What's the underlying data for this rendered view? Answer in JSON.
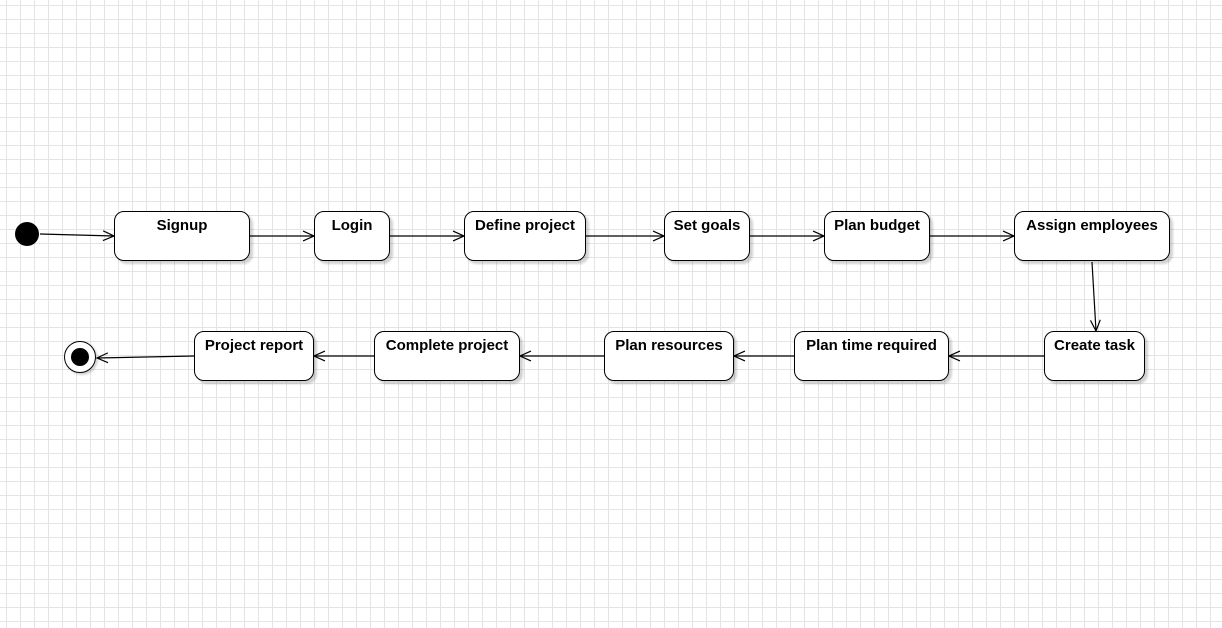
{
  "diagram": {
    "states": [
      {
        "id": "signup",
        "label": "Signup"
      },
      {
        "id": "login",
        "label": "Login"
      },
      {
        "id": "define-project",
        "label": "Define project"
      },
      {
        "id": "set-goals",
        "label": "Set goals"
      },
      {
        "id": "plan-budget",
        "label": "Plan budget"
      },
      {
        "id": "assign-employees",
        "label": "Assign employees"
      },
      {
        "id": "create-task",
        "label": "Create task"
      },
      {
        "id": "plan-time-required",
        "label": "Plan time required"
      },
      {
        "id": "plan-resources",
        "label": "Plan resources"
      },
      {
        "id": "complete-project",
        "label": "Complete project"
      },
      {
        "id": "project-report",
        "label": "Project report"
      }
    ],
    "transitions": [
      {
        "from": "initial",
        "to": "signup"
      },
      {
        "from": "signup",
        "to": "login"
      },
      {
        "from": "login",
        "to": "define-project"
      },
      {
        "from": "define-project",
        "to": "set-goals"
      },
      {
        "from": "set-goals",
        "to": "plan-budget"
      },
      {
        "from": "plan-budget",
        "to": "assign-employees"
      },
      {
        "from": "assign-employees",
        "to": "create-task"
      },
      {
        "from": "create-task",
        "to": "plan-time-required"
      },
      {
        "from": "plan-time-required",
        "to": "plan-resources"
      },
      {
        "from": "plan-resources",
        "to": "complete-project"
      },
      {
        "from": "complete-project",
        "to": "project-report"
      },
      {
        "from": "project-report",
        "to": "final"
      }
    ]
  }
}
